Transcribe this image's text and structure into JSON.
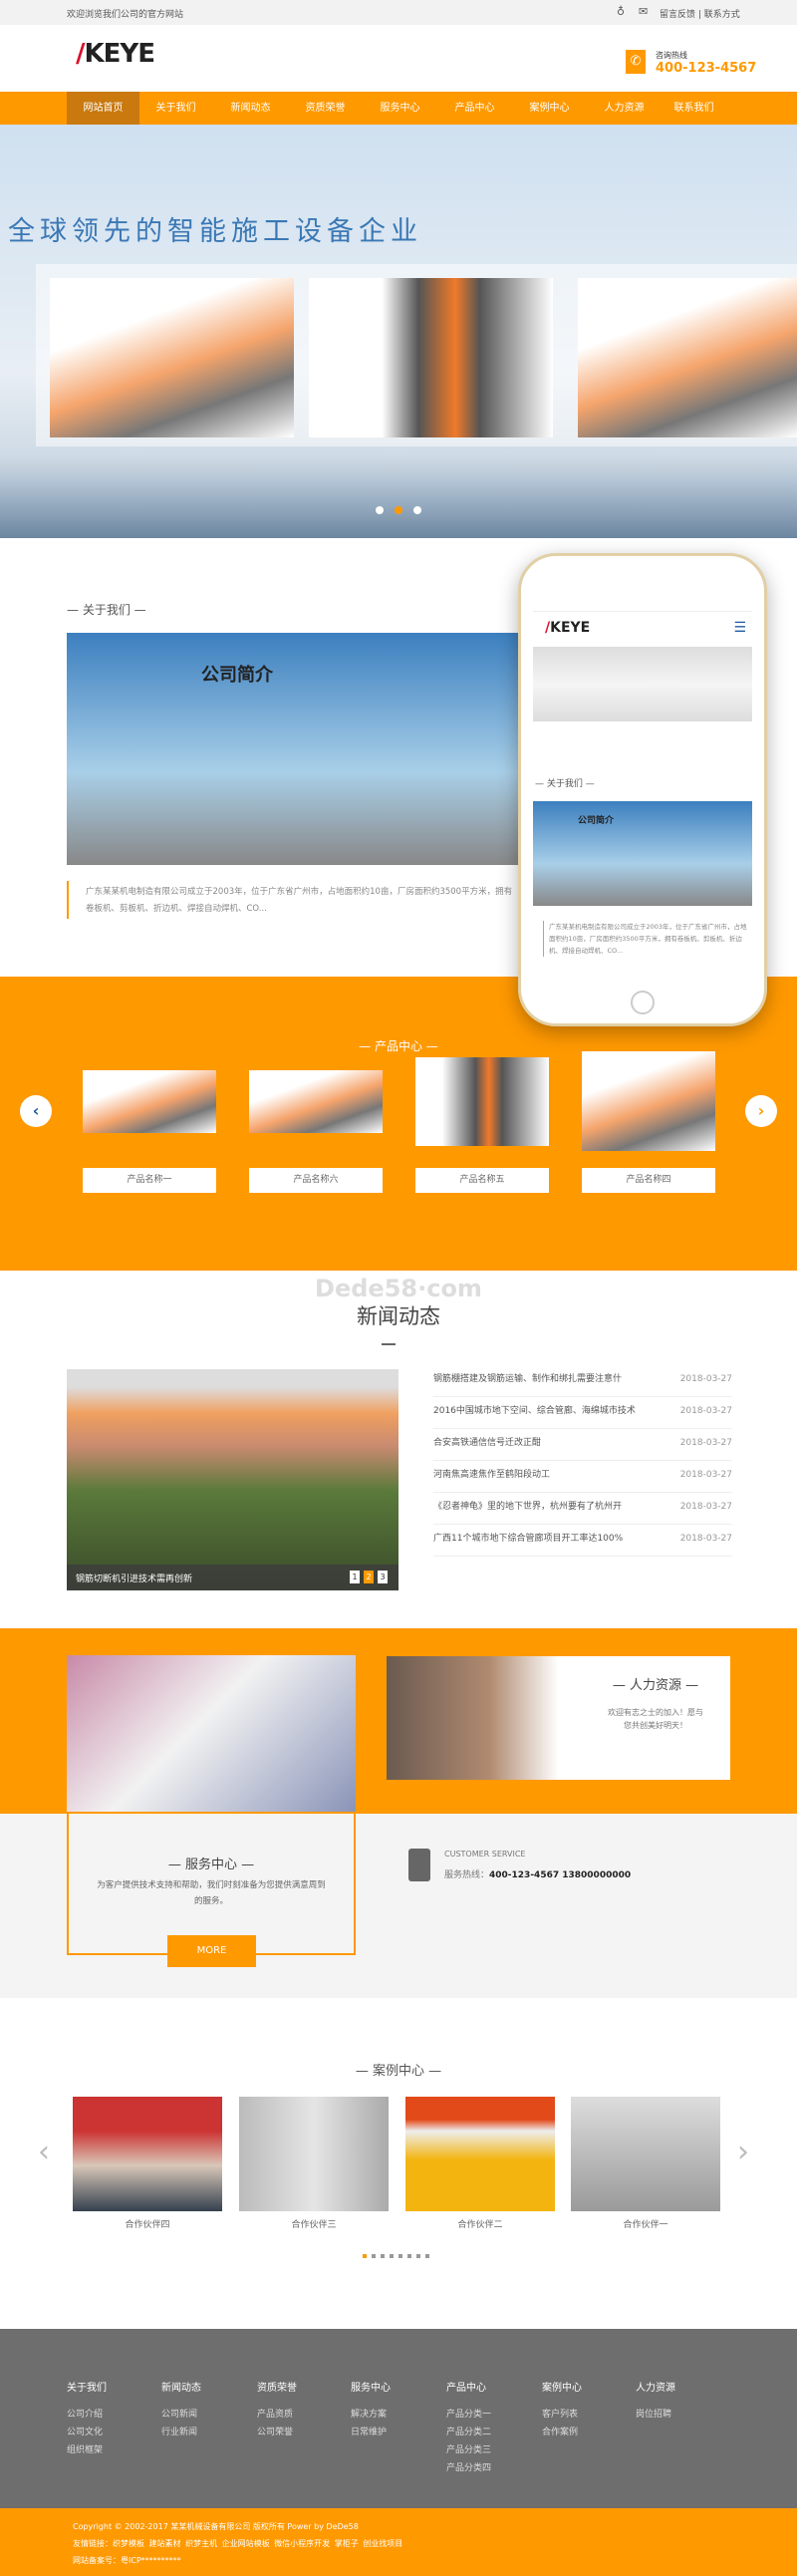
{
  "topbar": {
    "welcome": "欢迎浏览我们公司的官方网站",
    "links": "留言反馈 | 联系方式",
    "icons": [
      "weibo-icon",
      "wechat-icon"
    ]
  },
  "header": {
    "logo": "KEYE",
    "hotline_label": "咨询热线",
    "hotline": "400-123-4567"
  },
  "nav": {
    "items": [
      "网站首页",
      "关于我们",
      "新闻动态",
      "资质荣誉",
      "服务中心",
      "产品中心",
      "案例中心",
      "人力资源",
      "联系我们"
    ],
    "active": 0
  },
  "banner": {
    "slogan": "全球领先的智能施工设备企业",
    "active_dot": 1,
    "dots": 3
  },
  "about": {
    "title": "— 关于我们 —",
    "image_caption": "公司简介",
    "text": "广东某某机电制造有限公司成立于2003年，位于广东省广州市，占地面积约10亩，厂房面积约3500平方米，拥有卷板机、剪板机、折边机、焊接自动焊机、CO...",
    "phone": {
      "logo": "KEYE",
      "title": "— 关于我们 —",
      "caption": "公司简介",
      "text": "广东某某机电制造有限公司成立于2003年，位于广东省广州市，占地面积约10亩，厂房面积约3500平方米，拥有卷板机、剪板机、折边机、焊接自动焊机、CO..."
    }
  },
  "products": {
    "title": "— 产品中心 —",
    "items": [
      "产品名称一",
      "产品名称六",
      "产品名称五",
      "产品名称四"
    ]
  },
  "watermark": "Dede58·com",
  "news": {
    "title": "新闻动态",
    "featured_caption": "钢筋切断机引进技术需再创新",
    "pager": [
      "1",
      "2",
      "3"
    ],
    "pager_active": 1,
    "items": [
      {
        "title": "钢筋棚搭建及钢筋运输、制作和绑扎需要注意什",
        "date": "2018-03-27"
      },
      {
        "title": "2016中国城市地下空间、综合管廊、海绵城市技术",
        "date": "2018-03-27"
      },
      {
        "title": "合安高铁通信信号迁改正酣",
        "date": "2018-03-27"
      },
      {
        "title": "河南焦高速焦作至鹤阳段动工",
        "date": "2018-03-27"
      },
      {
        "title": "《忍者神龟》里的地下世界，杭州要有了杭州开",
        "date": "2018-03-27"
      },
      {
        "title": "广西11个城市地下综合管廊项目开工率达100%",
        "date": "2018-03-27"
      }
    ]
  },
  "hr": {
    "title": "— 人力资源 —",
    "text": "欢迎有志之士的加入！愿与您共创美好明天！"
  },
  "service": {
    "title": "— 服务中心 —",
    "text": "为客户提供技术支持和帮助，我们时刻准备为您提供满意周到的服务。",
    "more": "MORE",
    "cs_label": "CUSTOMER SERVICE",
    "hotline_label": "服务热线：",
    "hotline": "400-123-4567 13800000000"
  },
  "cases": {
    "title": "— 案例中心 —",
    "items": [
      "合作伙伴四",
      "合作伙伴三",
      "合作伙伴二",
      "合作伙伴一"
    ],
    "dots": 8,
    "active_dot": 0
  },
  "footer": {
    "columns": [
      {
        "title": "关于我们",
        "items": [
          "公司介绍",
          "公司文化",
          "组织框架"
        ]
      },
      {
        "title": "新闻动态",
        "items": [
          "公司新闻",
          "行业新闻"
        ]
      },
      {
        "title": "资质荣誉",
        "items": [
          "产品资质",
          "公司荣誉"
        ]
      },
      {
        "title": "服务中心",
        "items": [
          "解决方案",
          "日常维护"
        ]
      },
      {
        "title": "产品中心",
        "items": [
          "产品分类一",
          "产品分类二",
          "产品分类三",
          "产品分类四"
        ]
      },
      {
        "title": "案例中心",
        "items": [
          "客户列表",
          "合作案例"
        ]
      },
      {
        "title": "人力资源",
        "items": [
          "岗位招聘"
        ]
      }
    ],
    "copyright": "Copyright © 2002-2017 某某机械设备有限公司 版权所有 Power by DeDe58",
    "links_label": "友情链接：",
    "links": [
      "织梦模板",
      "建站素材",
      "织梦主机",
      "企业网站模板",
      "微信小程序开发",
      "掌柜子",
      "创业找项目"
    ],
    "icp": "网站备案号：粤ICP**********"
  },
  "colors": {
    "brand": "#ff9900",
    "nav_active": "#c9790e",
    "footer": "#6e6e6e"
  }
}
